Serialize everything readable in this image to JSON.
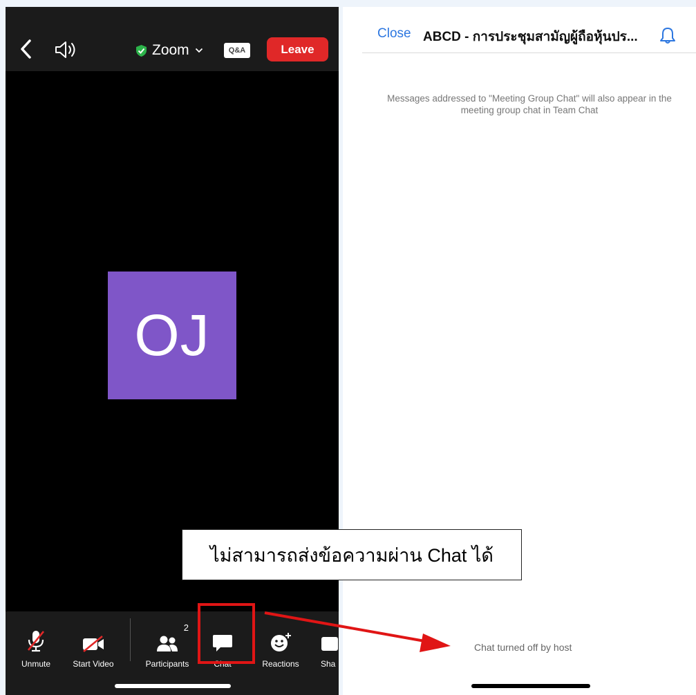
{
  "meeting": {
    "title": "Zoom",
    "qa_label": "Q&A",
    "leave_label": "Leave",
    "avatar_initials": "OJ",
    "avatar_color": "#7f56c8",
    "leave_color": "#e02828"
  },
  "toolbar": {
    "items": [
      {
        "label": "Unmute",
        "icon": "muted-mic-icon"
      },
      {
        "label": "Start Video",
        "icon": "video-off-icon"
      },
      {
        "label": "Participants",
        "icon": "participants-icon",
        "count": "2"
      },
      {
        "label": "Chat",
        "icon": "chat-bubble-icon"
      },
      {
        "label": "Reactions",
        "icon": "reactions-icon"
      },
      {
        "label": "Sha",
        "icon": "share-icon"
      }
    ]
  },
  "chat_panel": {
    "close_label": "Close",
    "title": "ABCD - การประชุมสามัญผู้ถือหุ้นปร...",
    "notice": "Messages addressed to \"Meeting Group Chat\" will also appear in the meeting group chat in Team Chat",
    "status": "Chat turned off by host",
    "link_color": "#2d77e0"
  },
  "annotation": {
    "callout_text": "ไม่สามารถส่งข้อความผ่าน Chat ได้",
    "highlight_color": "#e01515"
  }
}
